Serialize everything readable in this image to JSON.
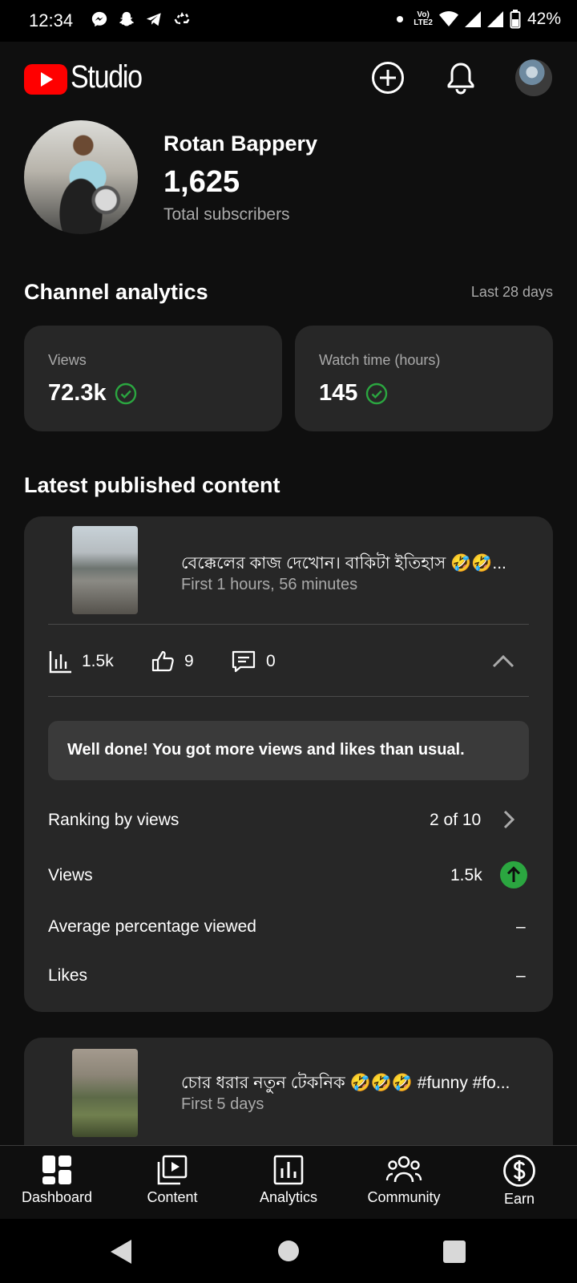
{
  "status_bar": {
    "time": "12:34",
    "network_top": "Vo)",
    "network_bottom": "LTE2",
    "battery": "42%",
    "icons": [
      "messenger-icon",
      "snapchat-icon",
      "telegram-icon",
      "recycle-icon",
      "dot-icon",
      "wifi-icon",
      "signal-icon",
      "signal-icon",
      "battery-icon"
    ]
  },
  "header": {
    "app_name": "Studio",
    "icons": [
      "create-icon",
      "notifications-icon",
      "account-avatar"
    ]
  },
  "channel": {
    "name": "Rotan Bappery",
    "subscribers": "1,625",
    "subscribers_label": "Total subscribers"
  },
  "analytics": {
    "title": "Channel analytics",
    "period": "Last 28 days",
    "metrics": [
      {
        "label": "Views",
        "value": "72.3k"
      },
      {
        "label": "Watch time (hours)",
        "value": "145"
      }
    ]
  },
  "latest": {
    "title": "Latest published content",
    "videos": [
      {
        "title": "বেক্কেলের কাজ দেখোন। বাকিটা ইতিহাস 🤣🤣...",
        "subtitle": "First 1 hours, 56 minutes",
        "views": "1.5k",
        "likes": "9",
        "comments": "0",
        "message": "Well done! You got more views and likes than usual.",
        "rows": [
          {
            "label": "Ranking by views",
            "value": "2 of 10"
          },
          {
            "label": "Views",
            "value": "1.5k"
          },
          {
            "label": "Average percentage viewed",
            "value": "–"
          },
          {
            "label": "Likes",
            "value": "–"
          }
        ]
      },
      {
        "title": "চোর ধরার নতুন টেকনিক 🤣🤣🤣 #funny #fo...",
        "subtitle": "First 5 days"
      }
    ]
  },
  "bottom_nav": [
    {
      "label": "Dashboard",
      "icon": "dashboard-icon"
    },
    {
      "label": "Content",
      "icon": "content-icon"
    },
    {
      "label": "Analytics",
      "icon": "analytics-icon"
    },
    {
      "label": "Community",
      "icon": "community-icon"
    },
    {
      "label": "Earn",
      "icon": "earn-icon"
    }
  ],
  "colors": {
    "accent_red": "#ff0000",
    "success_green": "#2ba640",
    "background": "#0f0f0f",
    "card": "#272727"
  }
}
